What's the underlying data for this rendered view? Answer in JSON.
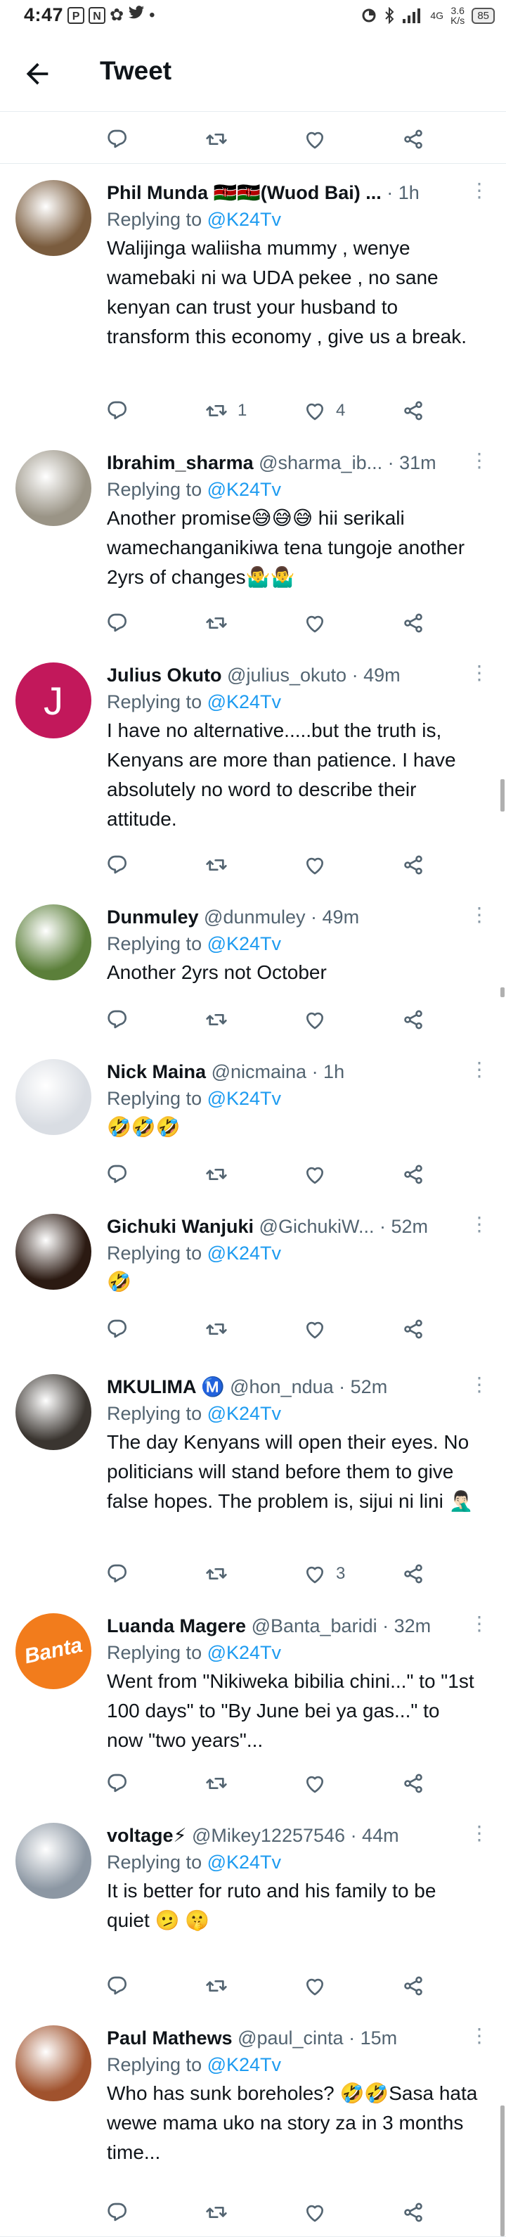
{
  "status_bar": {
    "time": "4:47",
    "left_icons": [
      "P",
      "N",
      "✿",
      "bird-glyph",
      "•"
    ],
    "network_speed_top": "4G",
    "network_speed": "3.6\nK/s",
    "battery": "85"
  },
  "header": {
    "title": "Tweet"
  },
  "tweets": [
    {
      "name": "Phil Munda 🇰🇪🇰🇪(Wuod Bai) ...",
      "handle": "",
      "time": "· 1h",
      "reply_prefix": "Replying to ",
      "reply_handle": "@K24Tv",
      "text": "Walijinga waliisha mummy , wenye wamebaki ni wa UDA pekee , no sane kenyan can trust your husband to transform this economy , give us a break.",
      "retweets": "1",
      "likes": "4",
      "avatar_color": "#7a5c3e"
    },
    {
      "name": "Ibrahim_sharma",
      "handle": "@sharma_ib...",
      "time": "· 31m",
      "reply_prefix": "Replying to ",
      "reply_handle": "@K24Tv",
      "text": "Another promise😅😅😅 hii serikali wamechanganikiwa tena tungoje another 2yrs of changes🤷‍♂️🤷‍♂️",
      "retweets": "",
      "likes": "",
      "avatar_color": "#9a9486"
    },
    {
      "name": "Julius Okuto",
      "handle": "@julius_okuto",
      "time": "· 49m",
      "reply_prefix": "Replying to ",
      "reply_handle": "@K24Tv",
      "text": "I have no alternative.....but the truth is, Kenyans are more than patience. I have absolutely no word to describe their attitude.",
      "retweets": "",
      "likes": "",
      "avatar_color": "#c2185b",
      "avatar_letter": "J"
    },
    {
      "name": "Dunmuley",
      "handle": "@dunmuley",
      "time": "· 49m",
      "reply_prefix": "Replying to ",
      "reply_handle": "@K24Tv",
      "text": "Another 2yrs not October",
      "retweets": "",
      "likes": "",
      "avatar_color": "#5b7f3a"
    },
    {
      "name": "Nick Maina",
      "handle": "@nicmaina",
      "time": "· 1h",
      "reply_prefix": "Replying to ",
      "reply_handle": "@K24Tv",
      "text": "🤣🤣🤣",
      "retweets": "",
      "likes": "",
      "avatar_color": "#d9dde3"
    },
    {
      "name": "Gichuki Wanjuki",
      "handle": "@GichukiW...",
      "time": "· 52m",
      "reply_prefix": "Replying to ",
      "reply_handle": "@K24Tv",
      "text": "🤣",
      "retweets": "",
      "likes": "",
      "avatar_color": "#2b1a12"
    },
    {
      "name": "MKULIMA Ⓜ️",
      "handle": "@hon_ndua",
      "time": "· 52m",
      "reply_prefix": "Replying to ",
      "reply_handle": "@K24Tv",
      "text": "The day Kenyans will open their eyes. No politicians will stand before them to give false hopes. The problem is, sijui ni lini 🤦🏻‍♂️",
      "retweets": "",
      "likes": "3",
      "avatar_color": "#3a3530"
    },
    {
      "name": "Luanda Magere",
      "handle": "@Banta_baridi",
      "time": "· 32m",
      "reply_prefix": "Replying to ",
      "reply_handle": "@K24Tv",
      "text": "Went from \"Nikiweka bibilia chini...\" to \"1st 100 days\" to \"By June bei ya gas...\" to now \"two years\"...",
      "retweets": "",
      "likes": "",
      "avatar_color": "#f27c1c",
      "avatar_letter": "Banta"
    },
    {
      "name": "voltage⚡",
      "handle": "@Mikey12257546",
      "time": "· 44m",
      "reply_prefix": "Replying to ",
      "reply_handle": "@K24Tv",
      "text": "It is better for ruto and his family to be quiet 🫤 🤫",
      "retweets": "",
      "likes": "",
      "avatar_color": "#8c97a3"
    },
    {
      "name": "Paul Mathews",
      "handle": "@paul_cinta",
      "time": "· 15m",
      "reply_prefix": "Replying to ",
      "reply_handle": "@K24Tv",
      "text": "Who has sunk boreholes? 🤣🤣Sasa hata wewe mama uko na story za in 3 months time...",
      "retweets": "",
      "likes": "",
      "avatar_color": "#a0522d"
    }
  ],
  "colors": {
    "accent": "#1d9bf0",
    "text": "#0f1419",
    "muted": "#536471",
    "divider": "#e6ecf0"
  }
}
